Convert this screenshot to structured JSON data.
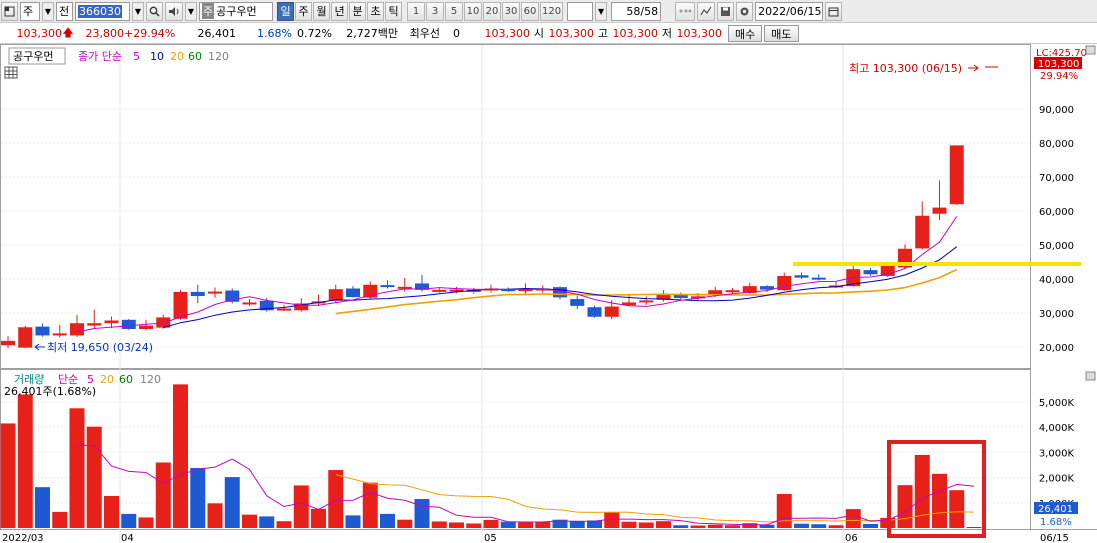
{
  "toolbar": {
    "market": "주",
    "market2": "전",
    "code": "366030",
    "name": "공구우먼",
    "name_prefix": "주",
    "periods": [
      "일",
      "주",
      "월",
      "년",
      "분",
      "초",
      "틱"
    ],
    "active_period": "일",
    "intervals": [
      "1",
      "3",
      "5",
      "10",
      "20",
      "30",
      "60",
      "120"
    ],
    "count": "58/58",
    "date": "2022/06/15"
  },
  "quote": {
    "price": "103,300",
    "change": "23,800",
    "change_pct": "+29.94%",
    "volume": "26,401",
    "volume_pct": "1.68%",
    "turnover_pct": "0.72%",
    "amount": "2,727백만",
    "pref_label": "최우선",
    "pref_value": "0",
    "bid": "103,300",
    "open_label": "시",
    "open": "103,300",
    "high_label": "고",
    "high": "103,300",
    "low_label": "저",
    "low": "103,300",
    "buy_label": "매수",
    "sell_label": "매도"
  },
  "price_panel": {
    "name_tag": "공구우먼",
    "legend_title": "종가 단순",
    "ma": [
      "5",
      "10",
      "20",
      "60",
      "120"
    ],
    "ma_colors": [
      "#c800c8",
      "#0000c8",
      "#f0a000",
      "#008000",
      "#808080"
    ],
    "high_note": "최고 103,300 (06/15)",
    "low_note": "최저 19,650 (03/24)",
    "right_lc": "LC:425.70",
    "right_price": "103,300",
    "right_pct": "29.94%"
  },
  "volume_panel": {
    "legend_title": "거래량",
    "legend_ma": "단순",
    "ma": [
      "5",
      "20",
      "60",
      "120"
    ],
    "current": "26,401주(1.68%)",
    "right_vol": "26,401",
    "right_pct": "1.68%"
  },
  "date_axis": [
    "2022/03",
    "04",
    "05",
    "06",
    "06/15"
  ],
  "chart_data": {
    "type": "candlestick",
    "price_axis": {
      "ticks": [
        20000,
        30000,
        40000,
        50000,
        60000,
        70000,
        80000,
        90000
      ],
      "labels": [
        "20,000",
        "30,000",
        "40,000",
        "50,000",
        "60,000",
        "70,000",
        "80,000",
        "90,000"
      ]
    },
    "volume_axis": {
      "ticks": [
        1000000,
        2000000,
        3000000,
        4000000,
        5000000
      ],
      "labels": [
        "1,000K",
        "2,000K",
        "3,000K",
        "4,000K",
        "5,000K"
      ]
    },
    "candles": [
      {
        "o": 20500,
        "c": 21800,
        "h": 23200,
        "l": 19650,
        "v": 4150000
      },
      {
        "o": 19800,
        "c": 25800,
        "h": 26200,
        "l": 19650,
        "v": 5300000
      },
      {
        "o": 26000,
        "c": 23400,
        "h": 26900,
        "l": 23000,
        "v": 1620000
      },
      {
        "o": 23400,
        "c": 24000,
        "h": 26500,
        "l": 22800,
        "v": 640000
      },
      {
        "o": 23400,
        "c": 27000,
        "h": 29500,
        "l": 23000,
        "v": 4750000
      },
      {
        "o": 26300,
        "c": 27000,
        "h": 31000,
        "l": 25300,
        "v": 4020000
      },
      {
        "o": 27000,
        "c": 27800,
        "h": 29000,
        "l": 25500,
        "v": 1270000
      },
      {
        "o": 28000,
        "c": 25300,
        "h": 28200,
        "l": 25100,
        "v": 560000
      },
      {
        "o": 25300,
        "c": 26300,
        "h": 28000,
        "l": 25000,
        "v": 420000
      },
      {
        "o": 25700,
        "c": 28700,
        "h": 29500,
        "l": 25400,
        "v": 2600000
      },
      {
        "o": 28300,
        "c": 36200,
        "h": 36800,
        "l": 28000,
        "v": 5700000
      },
      {
        "o": 36200,
        "c": 35000,
        "h": 38300,
        "l": 32900,
        "v": 2380000
      },
      {
        "o": 36300,
        "c": 36300,
        "h": 37500,
        "l": 34500,
        "v": 980000
      },
      {
        "o": 36600,
        "c": 33300,
        "h": 37200,
        "l": 32800,
        "v": 2020000
      },
      {
        "o": 33100,
        "c": 33100,
        "h": 34100,
        "l": 32100,
        "v": 530000
      },
      {
        "o": 33600,
        "c": 30800,
        "h": 34500,
        "l": 30400,
        "v": 460000
      },
      {
        "o": 31300,
        "c": 31300,
        "h": 32400,
        "l": 30600,
        "v": 270000
      },
      {
        "o": 30800,
        "c": 32800,
        "h": 34400,
        "l": 30400,
        "v": 1690000
      },
      {
        "o": 33100,
        "c": 33400,
        "h": 35400,
        "l": 32100,
        "v": 760000
      },
      {
        "o": 33600,
        "c": 37000,
        "h": 38300,
        "l": 33000,
        "v": 2300000
      },
      {
        "o": 37200,
        "c": 34700,
        "h": 37900,
        "l": 34500,
        "v": 500000
      },
      {
        "o": 34500,
        "c": 38300,
        "h": 39300,
        "l": 34200,
        "v": 1800000
      },
      {
        "o": 38200,
        "c": 37700,
        "h": 39600,
        "l": 37200,
        "v": 560000
      },
      {
        "o": 37700,
        "c": 37700,
        "h": 40300,
        "l": 36300,
        "v": 330000
      },
      {
        "o": 38700,
        "c": 36800,
        "h": 41200,
        "l": 36300,
        "v": 1150000
      },
      {
        "o": 36800,
        "c": 36800,
        "h": 37500,
        "l": 36000,
        "v": 260000
      },
      {
        "o": 36800,
        "c": 36900,
        "h": 37700,
        "l": 35800,
        "v": 220000
      },
      {
        "o": 36800,
        "c": 36800,
        "h": 37400,
        "l": 35700,
        "v": 180000
      },
      {
        "o": 36800,
        "c": 37200,
        "h": 38300,
        "l": 36000,
        "v": 320000
      },
      {
        "o": 37000,
        "c": 36800,
        "h": 37500,
        "l": 36200,
        "v": 250000
      },
      {
        "o": 36600,
        "c": 37000,
        "h": 38700,
        "l": 35200,
        "v": 220000
      },
      {
        "o": 37200,
        "c": 37200,
        "h": 38100,
        "l": 36000,
        "v": 250000
      },
      {
        "o": 37600,
        "c": 34600,
        "h": 37800,
        "l": 34000,
        "v": 330000
      },
      {
        "o": 34100,
        "c": 32100,
        "h": 35100,
        "l": 31200,
        "v": 270000
      },
      {
        "o": 31700,
        "c": 28900,
        "h": 32200,
        "l": 28600,
        "v": 300000
      },
      {
        "o": 28900,
        "c": 31900,
        "h": 33800,
        "l": 28200,
        "v": 620000
      },
      {
        "o": 32300,
        "c": 33100,
        "h": 35400,
        "l": 32000,
        "v": 250000
      },
      {
        "o": 33700,
        "c": 33700,
        "h": 34900,
        "l": 32400,
        "v": 220000
      },
      {
        "o": 33900,
        "c": 35600,
        "h": 36700,
        "l": 33400,
        "v": 270000
      },
      {
        "o": 35600,
        "c": 34400,
        "h": 36000,
        "l": 34100,
        "v": 110000
      },
      {
        "o": 34900,
        "c": 34900,
        "h": 35900,
        "l": 33600,
        "v": 100000
      },
      {
        "o": 35400,
        "c": 36700,
        "h": 37700,
        "l": 34700,
        "v": 130000
      },
      {
        "o": 36700,
        "c": 36700,
        "h": 37400,
        "l": 35700,
        "v": 110000
      },
      {
        "o": 35900,
        "c": 37900,
        "h": 38900,
        "l": 35600,
        "v": 190000
      },
      {
        "o": 37900,
        "c": 36900,
        "h": 38200,
        "l": 36200,
        "v": 130000
      },
      {
        "o": 36700,
        "c": 40900,
        "h": 41900,
        "l": 36500,
        "v": 1350000
      },
      {
        "o": 41100,
        "c": 40400,
        "h": 41900,
        "l": 40000,
        "v": 170000
      },
      {
        "o": 40400,
        "c": 40100,
        "h": 41400,
        "l": 39600,
        "v": 150000
      },
      {
        "o": 38100,
        "c": 38100,
        "h": 39100,
        "l": 37400,
        "v": 110000
      },
      {
        "o": 37900,
        "c": 42900,
        "h": 43900,
        "l": 37600,
        "v": 750000
      },
      {
        "o": 42600,
        "c": 41400,
        "h": 43200,
        "l": 41000,
        "v": 160000
      },
      {
        "o": 40900,
        "c": 44200,
        "h": 45100,
        "l": 40600,
        "v": 400000
      },
      {
        "o": 43400,
        "c": 48900,
        "h": 50200,
        "l": 43200,
        "v": 1700000
      },
      {
        "o": 49000,
        "c": 58600,
        "h": 62800,
        "l": 48700,
        "v": 2900000
      },
      {
        "o": 59200,
        "c": 61000,
        "h": 69000,
        "l": 57300,
        "v": 2150000
      },
      {
        "o": 62000,
        "c": 79300,
        "h": 79300,
        "l": 61800,
        "v": 1500000
      },
      {
        "o": 0,
        "c": 0,
        "h": 0,
        "l": 0,
        "v": 26401
      }
    ]
  }
}
